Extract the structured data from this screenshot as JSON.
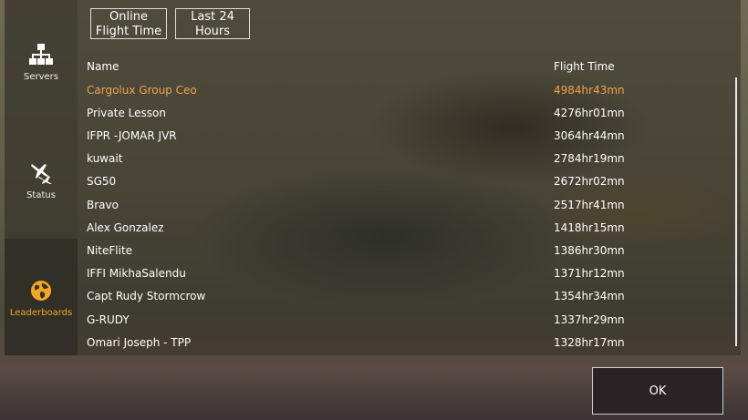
{
  "sidebar": {
    "items": [
      {
        "label": "Servers",
        "icon": "network-icon"
      },
      {
        "label": "Status",
        "icon": "airplanes-icon"
      },
      {
        "label": "Leaderboards",
        "icon": "globe-icon",
        "active": true
      }
    ]
  },
  "tabs": [
    {
      "label_line1": "Online",
      "label_line2": "Flight Time"
    },
    {
      "label_line1": "Last 24",
      "label_line2": "Hours"
    }
  ],
  "table": {
    "headers": {
      "name": "Name",
      "time": "Flight Time"
    },
    "rows": [
      {
        "name": "Cargolux Group Ceo",
        "time": "4984hr43mn"
      },
      {
        "name": "Private Lesson",
        "time": "4276hr01mn"
      },
      {
        "name": "IFPR -JOMAR JVR",
        "time": "3064hr44mn"
      },
      {
        "name": "kuwait",
        "time": "2784hr19mn"
      },
      {
        "name": "SG50",
        "time": "2672hr02mn"
      },
      {
        "name": "Bravo",
        "time": "2517hr41mn"
      },
      {
        "name": "Alex Gonzalez",
        "time": "1418hr15mn"
      },
      {
        "name": "NiteFlite",
        "time": "1386hr30mn"
      },
      {
        "name": "IFFI MikhaSalendu",
        "time": "1371hr12mn"
      },
      {
        "name": "Capt Rudy Stormcrow",
        "time": "1354hr34mn"
      },
      {
        "name": "G-RUDY",
        "time": "1337hr29mn"
      },
      {
        "name": "Omari Joseph - TPP",
        "time": "1328hr17mn"
      }
    ]
  },
  "ok_label": "OK",
  "colors": {
    "accent": "#f5a623",
    "highlight_row": "#f0a44a"
  }
}
